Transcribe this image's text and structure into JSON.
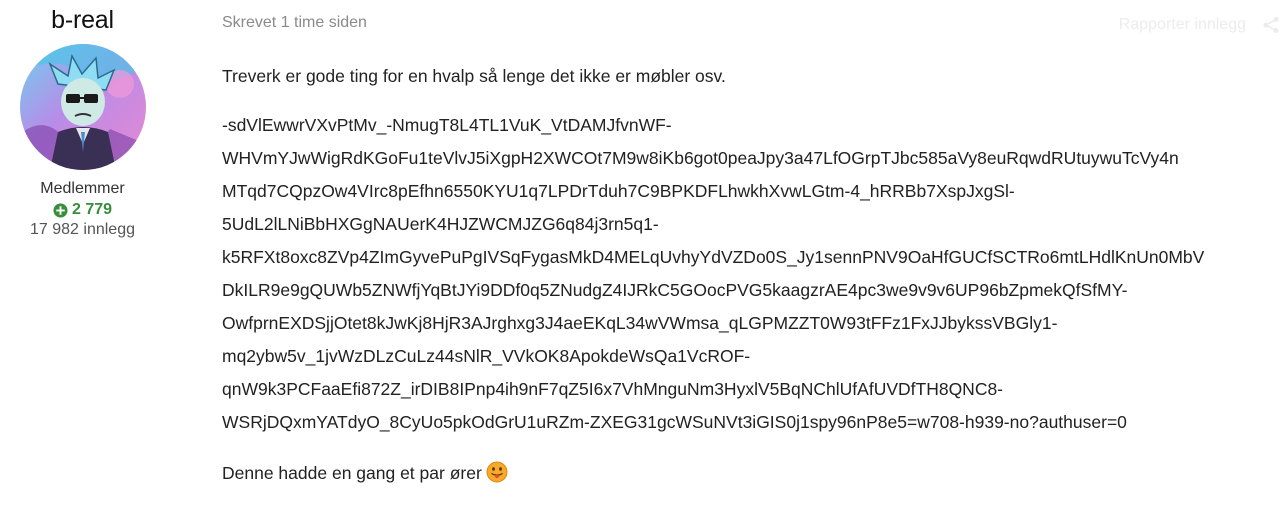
{
  "author": {
    "name": "b-real",
    "group": "Medlemmer",
    "reputation": "2 779",
    "posts": "17 982 innlegg"
  },
  "post": {
    "timestamp": "Skrevet 1 time siden",
    "report_label": "Rapporter innlegg",
    "paragraph1": "Treverk er gode ting for en hvalp så lenge det ikke er møbler osv.",
    "link_lines": [
      "-sdVlEwwrVXvPtMv_-NmugT8L4TL1VuK_VtDAMJfvnWF-",
      "WHVmYJwWigRdKGoFu1teVlvJ5iXgpH2XWCOt7M9w8iKb6got0peaJpy3a47LfOGrpTJbc585aVy8euRqwdRUtuywuTcVy4n",
      "MTqd7CQpzOw4VIrc8pEfhn6550KYU1q7LPDrTduh7C9BPKDFLhwkhXvwLGtm-4_hRRBb7XspJxgSl-",
      "5UdL2lLNiBbHXGgNAUerK4HJZWCMJZG6q84j3rn5q1-",
      "k5RFXt8oxc8ZVp4ZImGyvePuPgIVSqFygasMkD4MELqUvhyYdVZDo0S_Jy1sennPNV9OaHfGUCfSCTRo6mtLHdlKnUn0MbV",
      "DkILR9e9gQUWb5ZNWfjYqBtJYi9DDf0q5ZNudgZ4IJRkC5GOocPVG5kaagzrAE4pc3we9v9v6UP96bZpmekQfSfMY-",
      "OwfprnEXDSjjOtet8kJwKj8HjR3AJrghxg3J4aeEKqL34wVWmsa_qLGPMZZT0W93tFFz1FxJJbykssVBGly1-",
      "mq2ybw5v_1jvWzDLzCuLz44sNlR_VVkOK8ApokdeWsQa1VcROF-",
      "qnW9k3PCFaaEfi872Z_irDIB8IPnp4ih9nF7qZ5I6x7VhMnguNm3HyxlV5BqNChlUfAfUVDfTH8QNC8-",
      "WSRjDQxmYATdyO_8CyUo5pkOdGrU1uRZm-ZXEG31gcWSuNVt3iGIS0j1spy96nP8e5=w708-h939-no?authuser=0"
    ],
    "paragraph3": "Denne hadde en gang et par ører",
    "emoji": "tongue-out-face"
  },
  "colors": {
    "reputation_green": "#388e3c",
    "meta_gray": "#8a8a8a"
  }
}
